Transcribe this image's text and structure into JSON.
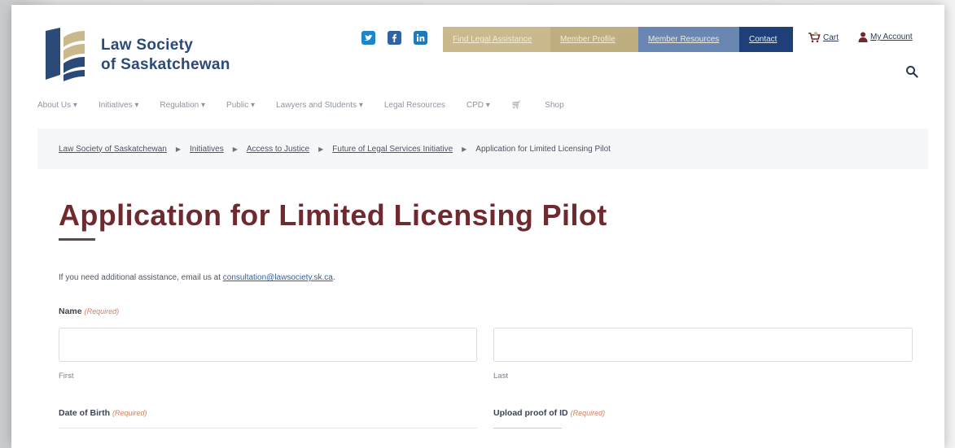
{
  "header": {
    "logo_line1": "Law Society",
    "logo_line2": "of Saskatchewan",
    "social": [
      "twitter-icon",
      "facebook-icon",
      "linkedin-icon"
    ],
    "topnav": [
      "Find Legal Assistance",
      "Member Profile",
      "Member Resources",
      "Contact"
    ],
    "cart_label": "Cart",
    "account_label": "My Account"
  },
  "mainnav": [
    "About Us ▾",
    "Initiatives ▾",
    "Regulation ▾",
    "Public ▾",
    "Lawyers and Students ▾",
    "Legal Resources",
    "CPD ▾",
    "Shop"
  ],
  "breadcrumb": [
    "Law Society of Saskatchewan",
    "Initiatives",
    "Access to Justice",
    "Future of Legal Services Initiative",
    "Application for Limited Licensing Pilot"
  ],
  "page": {
    "title": "Application for Limited Licensing Pilot",
    "help_prefix": "If you need additional assistance, email us at ",
    "help_email": "consultation@lawsociety.sk.ca",
    "help_suffix": "."
  },
  "form": {
    "name_label": "Name",
    "required": "(Required)",
    "first_label": "First",
    "last_label": "Last",
    "dob_label": "Date of Birth",
    "upload_label": "Upload proof of ID"
  },
  "colors": {
    "brand_blue": "#2b4a78",
    "title_maroon": "#6e2a2e",
    "gold": "#c9b98c",
    "navy": "#1f3f78"
  }
}
